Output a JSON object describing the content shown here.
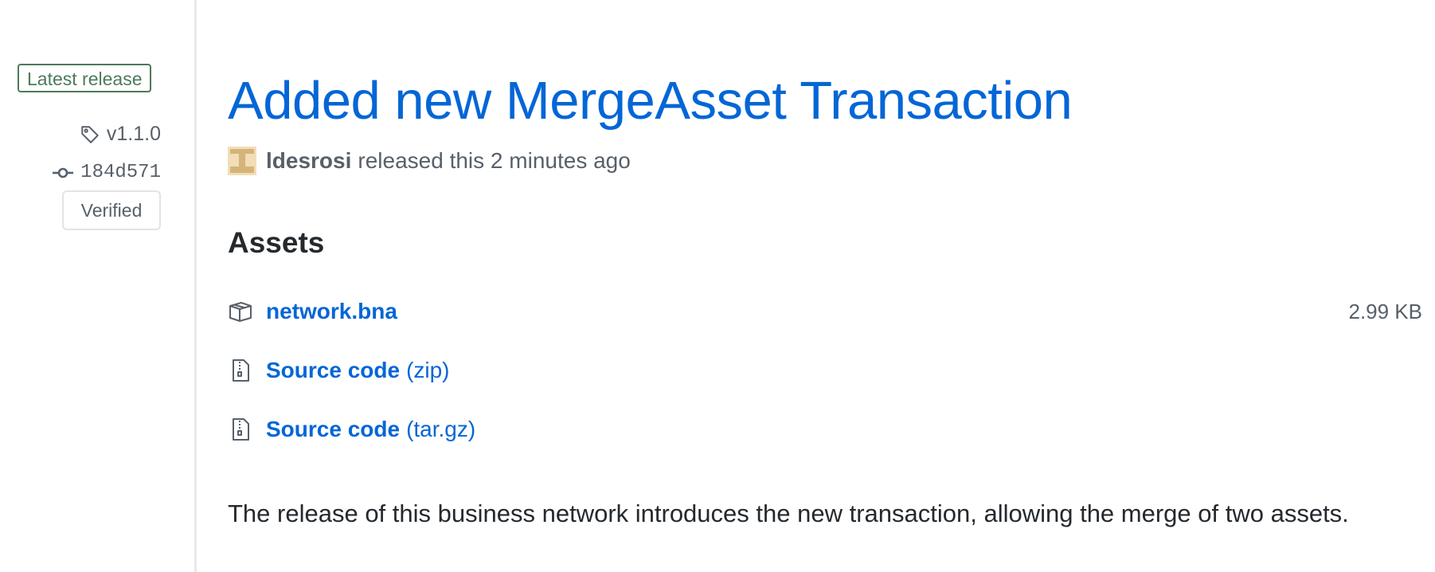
{
  "sidebar": {
    "latest_release_label": "Latest release",
    "tag": "v1.1.0",
    "commit": "184d571",
    "verified_label": "Verified"
  },
  "release": {
    "title": "Added new MergeAsset Transaction",
    "author": "ldesrosi",
    "released_text": "released this 2 minutes ago"
  },
  "assets": {
    "heading": "Assets",
    "items": [
      {
        "name": "network.bna",
        "suffix": "",
        "size": "2.99 KB",
        "icon": "package-icon"
      },
      {
        "name": "Source code",
        "suffix": "(zip)",
        "size": "",
        "icon": "file-zip-icon"
      },
      {
        "name": "Source code",
        "suffix": "(tar.gz)",
        "size": "",
        "icon": "file-zip-icon"
      }
    ]
  },
  "description": "The release of this business network introduces the new transaction, allowing the merge of two assets.",
  "colors": {
    "link": "#0366d6",
    "badge_green": "#4e7a5a",
    "muted": "#57606a",
    "divider": "#e6e8eb"
  }
}
